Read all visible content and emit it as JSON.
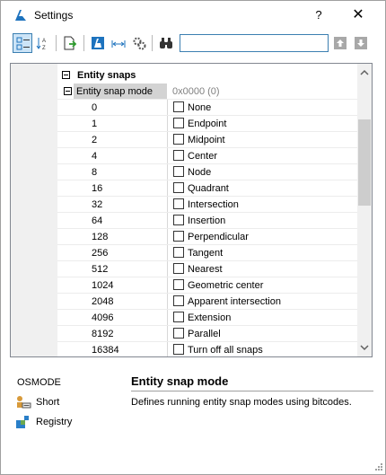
{
  "window": {
    "title": "Settings",
    "help_label": "?",
    "close_label": "✕"
  },
  "colors": {
    "accent": "#3c7fb1",
    "toolbar_active_bg": "#cce4f7",
    "group_column_bg": "#f0f0f0",
    "selected_label_bg": "#d3d3d3",
    "brand_blue": "#1e73be"
  },
  "toolbar": {
    "icons": [
      "categorized-view-icon",
      "alphabetical-view-icon",
      "export-icon",
      "run-command-icon",
      "dimension-icon",
      "settings-gear-icon",
      "find-binoculars-icon",
      "arrow-up-icon",
      "arrow-down-icon"
    ],
    "search_value": ""
  },
  "grid": {
    "group_label": "Entity snaps",
    "setting_label": "Entity snap mode",
    "setting_value": "0x0000 (0)",
    "flags": [
      {
        "code": "0",
        "label": "None",
        "checked": false
      },
      {
        "code": "1",
        "label": "Endpoint",
        "checked": false
      },
      {
        "code": "2",
        "label": "Midpoint",
        "checked": false
      },
      {
        "code": "4",
        "label": "Center",
        "checked": false
      },
      {
        "code": "8",
        "label": "Node",
        "checked": false
      },
      {
        "code": "16",
        "label": "Quadrant",
        "checked": false
      },
      {
        "code": "32",
        "label": "Intersection",
        "checked": false
      },
      {
        "code": "64",
        "label": "Insertion",
        "checked": false
      },
      {
        "code": "128",
        "label": "Perpendicular",
        "checked": false
      },
      {
        "code": "256",
        "label": "Tangent",
        "checked": false
      },
      {
        "code": "512",
        "label": "Nearest",
        "checked": false
      },
      {
        "code": "1024",
        "label": "Geometric center",
        "checked": false
      },
      {
        "code": "2048",
        "label": "Apparent intersection",
        "checked": false
      },
      {
        "code": "4096",
        "label": "Extension",
        "checked": false
      },
      {
        "code": "8192",
        "label": "Parallel",
        "checked": false
      },
      {
        "code": "16384",
        "label": "Turn off all snaps",
        "checked": false
      }
    ]
  },
  "info": {
    "variable": "OSMODE",
    "short_label": "Short",
    "registry_label": "Registry",
    "title": "Entity snap mode",
    "description": "Defines running entity snap modes using bitcodes."
  }
}
